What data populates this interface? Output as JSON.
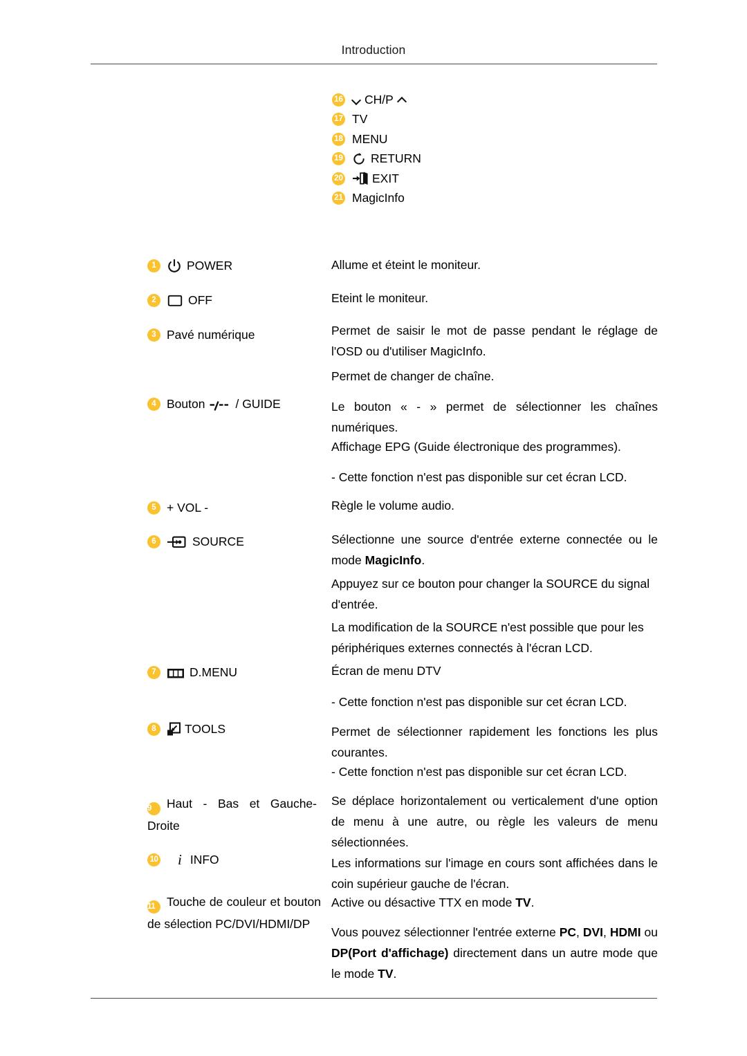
{
  "header": {
    "title": "Introduction"
  },
  "legend": [
    {
      "num": "16",
      "label": "CH/P",
      "icon_before": "chevron-down-icon",
      "icon_after": "chevron-up-icon"
    },
    {
      "num": "17",
      "label": "TV",
      "icon_before": "",
      "icon_after": ""
    },
    {
      "num": "18",
      "label": "MENU",
      "icon_before": "",
      "icon_after": ""
    },
    {
      "num": "19",
      "label": "RETURN",
      "icon_before": "return-arrow-icon",
      "icon_after": ""
    },
    {
      "num": "20",
      "label": "EXIT",
      "icon_before": "exit-door-icon",
      "icon_after": ""
    },
    {
      "num": "21",
      "label": "MagicInfo",
      "icon_before": "",
      "icon_after": ""
    }
  ],
  "items": {
    "power": {
      "num": "1",
      "label": "POWER",
      "icon": "power-icon"
    },
    "off": {
      "num": "2",
      "label": "OFF",
      "icon": "screen-off-icon"
    },
    "keypad": {
      "num": "3",
      "label": "Pavé numérique",
      "icon": ""
    },
    "guide": {
      "num": "4",
      "label_before": "Bouton",
      "icon": "dash-slash-icon",
      "label_after": "/ GUIDE"
    },
    "vol": {
      "num": "5",
      "label": "+ VOL -",
      "icon": ""
    },
    "source": {
      "num": "6",
      "label": "SOURCE",
      "icon": "source-input-icon"
    },
    "dmenu": {
      "num": "7",
      "label": "D.MENU",
      "icon": "dmenu-icon"
    },
    "tools": {
      "num": "8",
      "label": "TOOLS",
      "icon": "tools-icon"
    },
    "nav": {
      "num": "9",
      "label": "Haut - Bas et Gauche-Droite",
      "icon": ""
    },
    "info": {
      "num": "10",
      "label": "INFO",
      "icon": "info-italic-icon"
    },
    "color": {
      "num": "11",
      "label": "Touche de couleur et bouton de sélection PC/DVI/HDMI/DP",
      "icon": ""
    }
  },
  "descriptions": {
    "power": "Allume et éteint le moniteur.",
    "off": "Eteint le moniteur.",
    "keypad_1": "Permet de saisir le mot de passe pendant le réglage de l'OSD ou d'utiliser MagicInfo.",
    "keypad_2": "Permet de changer de chaîne.",
    "guide_1": "Le bouton « - » permet de sélectionner les chaînes numériques.",
    "guide_2": "Affichage EPG (Guide électronique des programmes).",
    "guide_3": "- Cette fonction n'est pas disponible sur cet écran LCD.",
    "vol": "Règle le volume audio.",
    "source_1_a": "Sélectionne une source d'entrée externe connectée ou le mode ",
    "source_1_b": "MagicInfo",
    "source_1_c": ".",
    "source_2": "Appuyez sur ce bouton pour changer la SOURCE du signal d'entrée.",
    "source_3": "La modification de la SOURCE n'est possible que pour les périphériques externes connectés à l'écran LCD.",
    "dmenu_1": "Écran de menu DTV",
    "dmenu_2": "- Cette fonction n'est pas disponible sur cet écran LCD.",
    "tools_1": "Permet de sélectionner rapidement les fonctions les plus courantes.",
    "tools_2": "- Cette fonction n'est pas disponible sur cet écran LCD.",
    "nav": "Se déplace horizontalement ou verticalement d'une option de menu à une autre, ou règle les valeurs de menu sélectionnées.",
    "info": "Les informations sur l'image en cours sont affichées dans le coin supérieur gauche de l'écran.",
    "color_1_a": "Active ou désactive TTX en mode ",
    "color_1_b": "TV",
    "color_1_c": ".",
    "color_2_a": "Vous pouvez sélectionner l'entrée externe ",
    "color_2_pc": "PC",
    "color_2_b": ", ",
    "color_2_dvi": "DVI",
    "color_2_c": ", ",
    "color_2_hdmi": "HDMI",
    "color_2_d": " ou ",
    "color_2_dp": "DP(Port d'affichage)",
    "color_2_e": " directement dans un autre mode que le mode ",
    "color_2_tv": "TV",
    "color_2_f": "."
  },
  "colors": {
    "badge_background": "#F9C22E",
    "badge_text": "#FFFFFF",
    "rule": "#4A4A4A",
    "text": "#000000"
  }
}
